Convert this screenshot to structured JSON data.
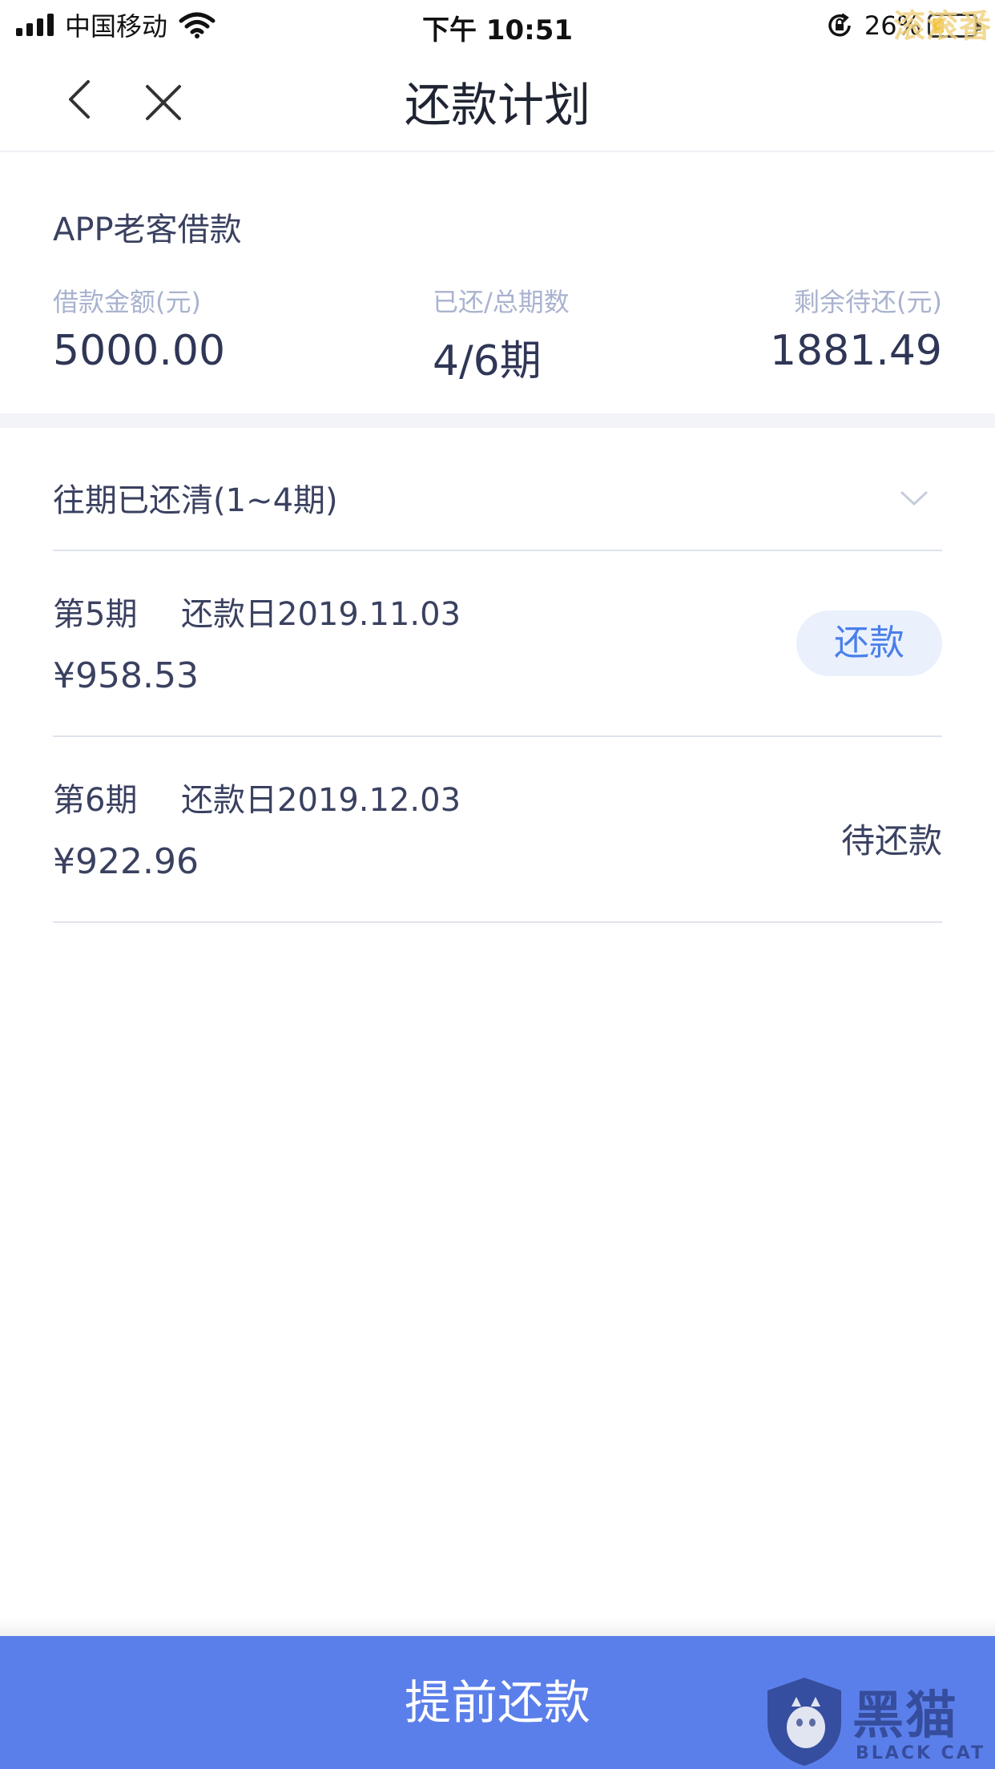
{
  "status_bar": {
    "carrier": "中国移动",
    "time": "下午 10:51",
    "battery": "26%",
    "overlay_text": "滚滚番"
  },
  "nav": {
    "title": "还款计划",
    "back_icon": "chevron-left-icon",
    "close_icon": "close-icon"
  },
  "summary": {
    "loan_name": "APP老客借款",
    "stats": [
      {
        "label": "借款金额(元)",
        "value": "5000.00"
      },
      {
        "label": "已还/总期数",
        "value": "4/6期"
      },
      {
        "label": "剩余待还(元)",
        "value": "1881.49"
      }
    ]
  },
  "history": {
    "label": "往期已还清(1~4期)",
    "icon": "chevron-down-icon"
  },
  "installments": [
    {
      "period": "第5期",
      "due": "还款日2019.11.03",
      "amount": "¥958.53",
      "action": "还款"
    },
    {
      "period": "第6期",
      "due": "还款日2019.12.03",
      "amount": "¥922.96",
      "status": "待还款"
    }
  ],
  "bottom": {
    "button": "提前还款"
  },
  "watermark": {
    "cn": "黑猫",
    "en": "BLACK CAT"
  },
  "colors": {
    "accent": "#5b7fea",
    "pay_button_bg": "#eaf1fd",
    "pay_button_text": "#4a7fea",
    "label_gray": "#a9b3cf",
    "text_dark": "#3a4160"
  }
}
